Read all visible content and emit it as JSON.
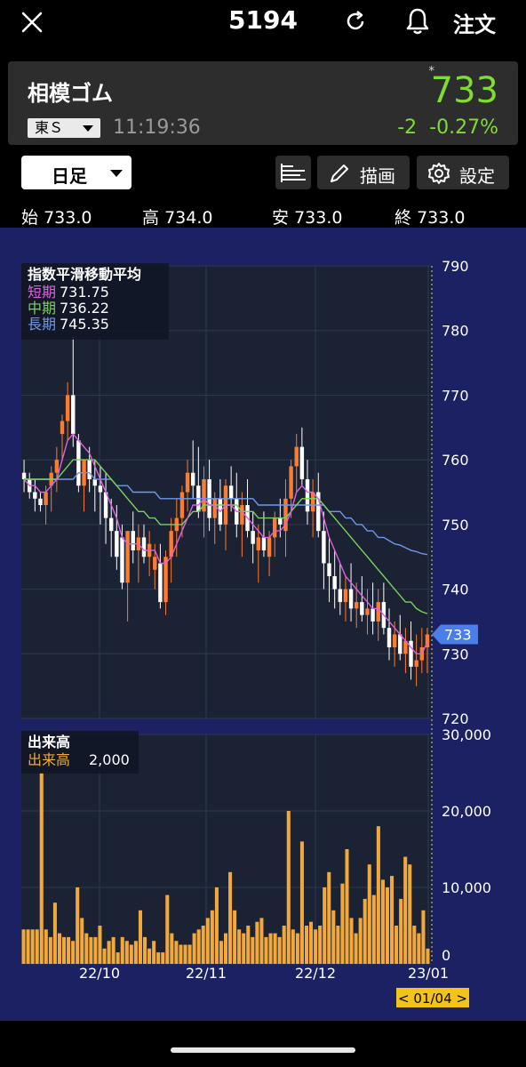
{
  "header": {
    "code": "5194",
    "order_label": "注文",
    "icons": [
      "close-icon",
      "refresh-icon",
      "bell-icon"
    ]
  },
  "quote": {
    "name": "相模ゴム",
    "market": "東Ｓ",
    "time": "11:19:36",
    "price": "733",
    "star": "*",
    "change": "-2",
    "change_pct": "-0.27%",
    "price_color": "#7fdc33"
  },
  "toolbar": {
    "period": "日足",
    "draw_label": "描画",
    "settings_label": "設定"
  },
  "ohlc": {
    "open_label": "始",
    "open": "733.0",
    "high_label": "高",
    "high": "734.0",
    "low_label": "安",
    "low": "733.0",
    "close_label": "終",
    "close": "733.0"
  },
  "indicator_legend": {
    "title": "指数平滑移動平均",
    "short_label": "短期",
    "short_value": "731.75",
    "mid_label": "中期",
    "mid_value": "736.22",
    "long_label": "長期",
    "long_value": "745.35"
  },
  "volume_legend": {
    "title": "出来高",
    "label": "出来高",
    "value": "2,000"
  },
  "date_badge": "< 01/04 >",
  "price_tag": "733",
  "chart_data": [
    {
      "type": "candlestick",
      "title": "",
      "ylim": [
        720,
        790
      ],
      "yticks": [
        "790",
        "780",
        "770",
        "760",
        "750",
        "740",
        "730",
        "720"
      ],
      "xtick_labels": [
        "22/10",
        "22/11",
        "22/12",
        "23/01"
      ],
      "colors": {
        "up": "#ff7b2e",
        "down": "#ffffff",
        "short": "#e060e0",
        "mid": "#7bd25a",
        "long": "#6f98ea"
      },
      "candles": [
        [
          758,
          760,
          755,
          757
        ],
        [
          757,
          758,
          754,
          755
        ],
        [
          755,
          757,
          752,
          754
        ],
        [
          754,
          755,
          752,
          753
        ],
        [
          753,
          756,
          750,
          755
        ],
        [
          756,
          759,
          752,
          758
        ],
        [
          758,
          762,
          755,
          760
        ],
        [
          764,
          767,
          760,
          766
        ],
        [
          766,
          772,
          763,
          770
        ],
        [
          770,
          779,
          762,
          764
        ],
        [
          763,
          764,
          755,
          756
        ],
        [
          756,
          760,
          752,
          760
        ],
        [
          760,
          762,
          755,
          757
        ],
        [
          757,
          760,
          752,
          756
        ],
        [
          756,
          759,
          750,
          755
        ],
        [
          755,
          758,
          747,
          751
        ],
        [
          751,
          754,
          745,
          749
        ],
        [
          749,
          753,
          743,
          745
        ],
        [
          748,
          750,
          740,
          741
        ],
        [
          741,
          747,
          735,
          749
        ],
        [
          749,
          752,
          744,
          746
        ],
        [
          746,
          750,
          741,
          748
        ],
        [
          748,
          750,
          744,
          745
        ],
        [
          745,
          749,
          742,
          747
        ],
        [
          743,
          747,
          740,
          745
        ],
        [
          744,
          747,
          737,
          738
        ],
        [
          738,
          746,
          736,
          745
        ],
        [
          745,
          751,
          741,
          749
        ],
        [
          749,
          754,
          745,
          751
        ],
        [
          751,
          756,
          748,
          755
        ],
        [
          755,
          760,
          752,
          758
        ],
        [
          758,
          763,
          754,
          756
        ],
        [
          756,
          762,
          751,
          752
        ],
        [
          752,
          759,
          748,
          757
        ],
        [
          757,
          760,
          749,
          751
        ],
        [
          751,
          755,
          747,
          754
        ],
        [
          754,
          757,
          749,
          750
        ],
        [
          750,
          757,
          746,
          756
        ],
        [
          756,
          759,
          752,
          754
        ],
        [
          754,
          758,
          748,
          750
        ],
        [
          750,
          755,
          745,
          753
        ],
        [
          753,
          757,
          748,
          749
        ],
        [
          749,
          752,
          744,
          747
        ],
        [
          746,
          750,
          741,
          748
        ],
        [
          748,
          752,
          745,
          746
        ],
        [
          745,
          749,
          742,
          748
        ],
        [
          748,
          752,
          745,
          751
        ],
        [
          751,
          754,
          748,
          750
        ],
        [
          749,
          757,
          745,
          754
        ],
        [
          754,
          760,
          751,
          759
        ],
        [
          759,
          764,
          755,
          762
        ],
        [
          762,
          765,
          756,
          757
        ],
        [
          757,
          760,
          750,
          752
        ],
        [
          752,
          757,
          748,
          755
        ],
        [
          755,
          758,
          748,
          749
        ],
        [
          749,
          752,
          740,
          744
        ],
        [
          744,
          748,
          738,
          742
        ],
        [
          742,
          746,
          737,
          740
        ],
        [
          740,
          744,
          736,
          738
        ],
        [
          738,
          742,
          735,
          740
        ],
        [
          740,
          744,
          735,
          737
        ],
        [
          737,
          741,
          734,
          738
        ],
        [
          738,
          742,
          735,
          736
        ],
        [
          736,
          740,
          733,
          737
        ],
        [
          737,
          741,
          733,
          735
        ],
        [
          735,
          740,
          732,
          738
        ],
        [
          738,
          741,
          733,
          734
        ],
        [
          734,
          737,
          729,
          731
        ],
        [
          731,
          735,
          728,
          733
        ],
        [
          733,
          736,
          729,
          730
        ],
        [
          730,
          734,
          727,
          732
        ],
        [
          732,
          735,
          726,
          728
        ],
        [
          728,
          733,
          725,
          729
        ],
        [
          729,
          734,
          727,
          731
        ],
        [
          731,
          734,
          727,
          733
        ]
      ],
      "ma_short": [
        757,
        756,
        756,
        755,
        755,
        756,
        757,
        760,
        763,
        764,
        763,
        762,
        761,
        759,
        757,
        755,
        753,
        751,
        748,
        747,
        747,
        747,
        746,
        746,
        746,
        744,
        744,
        745,
        747,
        749,
        751,
        753,
        753,
        754,
        753,
        753,
        752,
        753,
        753,
        752,
        752,
        751,
        750,
        749,
        748,
        748,
        749,
        749,
        750,
        752,
        755,
        756,
        755,
        755,
        754,
        751,
        748,
        746,
        744,
        742,
        741,
        740,
        739,
        738,
        737,
        737,
        736,
        735,
        734,
        733,
        732,
        731,
        730,
        730,
        731.75
      ],
      "ma_mid": [
        757,
        757,
        757,
        757,
        757,
        757,
        757,
        758,
        759,
        760,
        760,
        760,
        760,
        760,
        759,
        758,
        757,
        756,
        755,
        754,
        753,
        752,
        752,
        751,
        751,
        750,
        750,
        750,
        750,
        750,
        751,
        752,
        752,
        753,
        753,
        753,
        753,
        753,
        753,
        753,
        752,
        752,
        752,
        751,
        751,
        751,
        751,
        751,
        751,
        752,
        753,
        754,
        754,
        754,
        754,
        753,
        752,
        751,
        750,
        749,
        748,
        747,
        746,
        745,
        744,
        743,
        742,
        741,
        740,
        739,
        738,
        738,
        737,
        736.5,
        736.22
      ],
      "ma_long": [
        757,
        757,
        757,
        757,
        757,
        757,
        757,
        757,
        757,
        757,
        758,
        758,
        758,
        757,
        757,
        757,
        757,
        756,
        756,
        756,
        755,
        755,
        755,
        755,
        755,
        754,
        754,
        754,
        754,
        754,
        754,
        754,
        754,
        754,
        754,
        754,
        754,
        754,
        754,
        754,
        754,
        754,
        754,
        753,
        753,
        753,
        753,
        753,
        753,
        753,
        753,
        753,
        753,
        753,
        753,
        753,
        752,
        752,
        752,
        751,
        751,
        750,
        750,
        749,
        749,
        748,
        748,
        747.5,
        747,
        746.8,
        746.4,
        746,
        745.8,
        745.5,
        745.35
      ]
    },
    {
      "type": "bar",
      "title": "",
      "ylim": [
        0,
        30000
      ],
      "yticks": [
        "30,000",
        "20,000",
        "10,000",
        "0"
      ],
      "values": [
        4500,
        4500,
        4500,
        4500,
        25000,
        4500,
        3500,
        8000,
        4000,
        3500,
        3500,
        3000,
        10000,
        6000,
        4000,
        3500,
        3500,
        5000,
        2000,
        3000,
        3500,
        1500,
        3500,
        3000,
        2500,
        3000,
        7000,
        3500,
        2000,
        3000,
        1500,
        1500,
        9000,
        4000,
        3000,
        2500,
        2500,
        2500,
        4000,
        4500,
        5000,
        6000,
        7000,
        10000,
        3000,
        4000,
        12000,
        7000,
        4500,
        4000,
        5000,
        3500,
        5500,
        6000,
        3500,
        4000,
        4000,
        3500,
        5000,
        20000,
        4500,
        4000,
        16000,
        5000,
        5500,
        4500,
        5000,
        10000,
        12000,
        7000,
        5000,
        10500,
        15000,
        6000,
        4000,
        6000,
        8500,
        13000,
        9000,
        18000,
        11000,
        10000,
        11500,
        5000,
        8500,
        14000,
        13000,
        5000,
        4000,
        7000,
        2000
      ]
    }
  ]
}
